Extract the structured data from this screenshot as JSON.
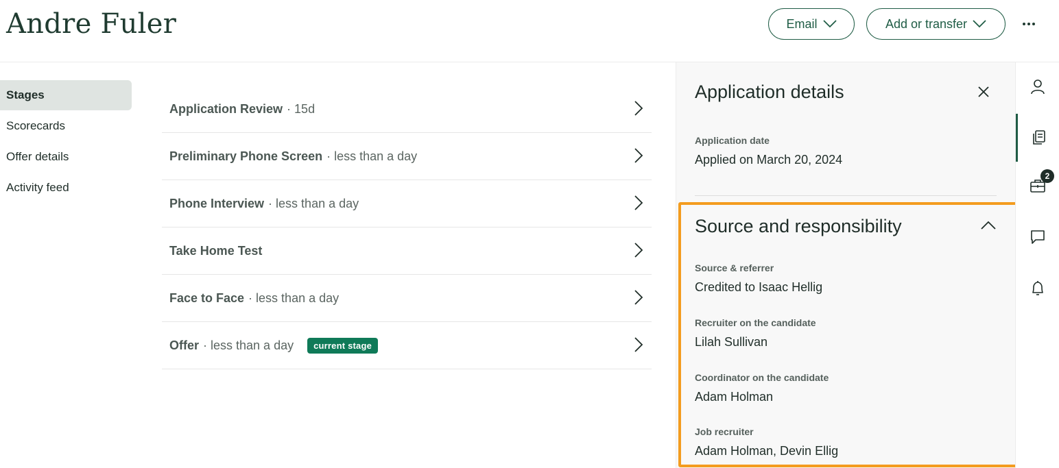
{
  "candidate": {
    "name": "Andre Fuler"
  },
  "header": {
    "email_label": "Email",
    "transfer_label": "Add or transfer"
  },
  "nav": {
    "items": [
      {
        "label": "Stages",
        "active": true
      },
      {
        "label": "Scorecards",
        "active": false
      },
      {
        "label": "Offer details",
        "active": false
      },
      {
        "label": "Activity feed",
        "active": false
      }
    ]
  },
  "stages": [
    {
      "name": "Application Review",
      "duration": "· 15d"
    },
    {
      "name": "Preliminary Phone Screen",
      "duration": "· less than a day"
    },
    {
      "name": "Phone Interview",
      "duration": "· less than a day"
    },
    {
      "name": "Take Home Test",
      "duration": ""
    },
    {
      "name": "Face to Face",
      "duration": "· less than a day"
    },
    {
      "name": "Offer",
      "duration": "· less than a day",
      "badge": "current stage"
    }
  ],
  "panel": {
    "title": "Application details",
    "application_date_label": "Application date",
    "application_date_value": "Applied on March 20, 2024",
    "section_title": "Source and responsibility",
    "fields": [
      {
        "label": "Source & referrer",
        "value": "Credited to Isaac Hellig"
      },
      {
        "label": "Recruiter on the candidate",
        "value": "Lilah Sullivan"
      },
      {
        "label": "Coordinator on the candidate",
        "value": "Adam Holman"
      },
      {
        "label": "Job recruiter",
        "value": "Adam Holman, Devin Ellig"
      }
    ]
  },
  "rail": {
    "items": [
      {
        "icon": "person-icon"
      },
      {
        "icon": "documents-icon",
        "active": true
      },
      {
        "icon": "briefcase-icon",
        "badge": "2"
      },
      {
        "icon": "chat-icon"
      },
      {
        "icon": "bell-icon"
      }
    ]
  },
  "colors": {
    "brand": "#1f5c45",
    "badge": "#0f7a58",
    "highlight": "#f39c1f"
  }
}
